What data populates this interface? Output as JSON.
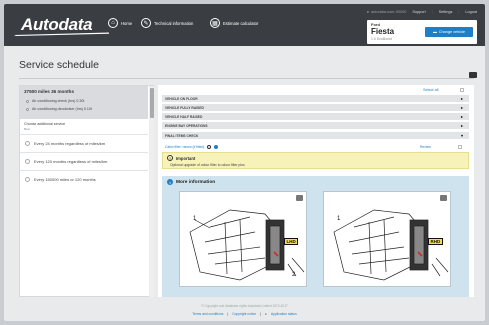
{
  "header": {
    "logo_text": "Autodata",
    "nav": [
      {
        "label": "Home",
        "icon": "home-icon"
      },
      {
        "label": "Technical information",
        "icon": "wrench-icon"
      },
      {
        "label": "Estimate calculator",
        "icon": "calculator-icon"
      }
    ],
    "user_label": "autodata-user-00000",
    "top_links": [
      "Support",
      "Settings",
      "Logout"
    ],
    "vehicle": {
      "make": "Ford",
      "model": "Fiesta",
      "engine": "1.0 EcoBoost",
      "change_button": "Change vehicle"
    }
  },
  "page": {
    "title": "Service schedule"
  },
  "left_panel": {
    "interval_title": "37500 miles 36 months",
    "interval_items": [
      "Air conditioning check (hrs) 0.30t",
      "Air conditioning deodoriser (hrs) 0.10t"
    ],
    "choose_label": "Choose additional service",
    "choose_sub": "Best",
    "additional_options": [
      "Every 24 months regardless of miles/km",
      "Every 120 months regardless of miles/km",
      "Every 150000 miles or 120 months"
    ]
  },
  "right_panel": {
    "select_all": "Select all",
    "operations": [
      "VEHICLE ON FLOOR",
      "VEHICLE FULLY RAISED",
      "VEHICLE HALF RAISED",
      "ENGINE BAY OPERATIONS",
      "FINAL ITEMS CHECK"
    ],
    "cabin_item": "Cabin filter: renew (if fitted)",
    "review_label": "Review",
    "important_title": "Important",
    "important_body": "Optional upgrade of odour filter to odour filter plus",
    "more_info_title": "More information",
    "diagram_tags": [
      "LHD",
      "RHD"
    ]
  },
  "footer": {
    "copyright": "© Copyright and database rights Autodata Limited 1972-2017",
    "links": [
      "Terms and conditions",
      "Copyright notice",
      "Application status"
    ]
  },
  "colors": {
    "header_bg": "#3a3d42",
    "accent": "#1e7fc6",
    "important_bg": "#f6f2b8",
    "more_info_bg": "#cfe3ee",
    "status_green": "#2e9a3e"
  }
}
